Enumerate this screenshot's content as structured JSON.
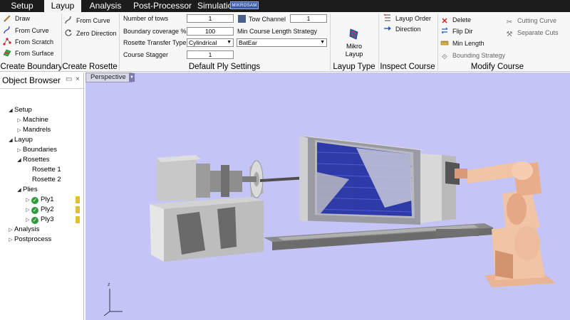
{
  "menu": {
    "tabs": [
      {
        "label": "Setup"
      },
      {
        "label": "Layup"
      },
      {
        "label": "Analysis"
      },
      {
        "label": "Post-Processor"
      },
      {
        "label": "Simulation"
      }
    ],
    "active_tab": "Layup",
    "brand_badge": "MIKROSAM"
  },
  "ribbon": {
    "create_boundary": {
      "caption": "Create Boundary",
      "items": [
        "Draw",
        "From Curve",
        "From Scratch",
        "From Surface"
      ]
    },
    "create_rosette": {
      "caption": "Create Rosette",
      "items": [
        "From Curve",
        "Zero Direction"
      ]
    },
    "default_ply": {
      "caption": "Default Ply Settings",
      "number_of_tows_label": "Number of tows",
      "number_of_tows_value": "1",
      "boundary_coverage_label": "Boundary coverage %",
      "boundary_coverage_value": "100",
      "rosette_transfer_label": "Rosette Transfer Type",
      "rosette_transfer_value": "Cylindrical",
      "course_stagger_label": "Course Stagger",
      "course_stagger_value": "1",
      "tow_channel_label": "Tow Channel",
      "tow_channel_value": "1",
      "min_course_label": "Min Course Length Strategy",
      "min_course_value": "BatEar"
    },
    "layup_type": {
      "caption": "Layup Type",
      "button_line1": "Mikro",
      "button_line2": "Layup"
    },
    "inspect_course": {
      "caption": "Inspect Course",
      "items": [
        "Layup Order",
        "Direction"
      ]
    },
    "modify_course": {
      "caption": "Modify Course",
      "items": [
        "Delete",
        "Flip Dir",
        "Min Length",
        "Bounding Strategy",
        "Cutting Curve",
        "Separate Cuts"
      ]
    }
  },
  "object_browser": {
    "title": "Object Browser",
    "tree": [
      {
        "label": "Setup"
      },
      {
        "label": "Machine"
      },
      {
        "label": "Mandrels"
      },
      {
        "label": "Layup"
      },
      {
        "label": "Boundaries"
      },
      {
        "label": "Rosettes"
      },
      {
        "label": "Rosette 1"
      },
      {
        "label": "Rosette 2"
      },
      {
        "label": "Plies"
      },
      {
        "label": "Ply1"
      },
      {
        "label": "Ply2"
      },
      {
        "label": "Ply3"
      },
      {
        "label": "Analysis"
      },
      {
        "label": "Postprocess"
      }
    ]
  },
  "viewport": {
    "view_name": "Perspective",
    "background_color": "#c4c4f7"
  },
  "colors": {
    "menubar": "#1c1c1c",
    "active_tab": "#f3f3f3",
    "ply_fill": "#2e3aa8",
    "robot": "#f1c4a6"
  }
}
